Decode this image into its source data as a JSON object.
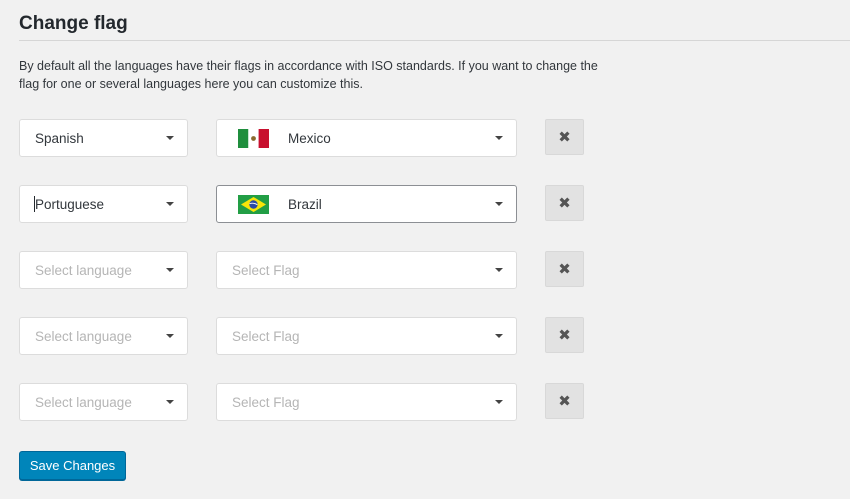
{
  "page": {
    "title": "Change flag",
    "description": "By default all the languages have their flags in accordance with ISO standards. If you want to change the flag for one or several languages here you can customize this."
  },
  "rows": [
    {
      "language": "Spanish",
      "flag": "Mexico",
      "flag_icon": "mexico-flag-icon"
    },
    {
      "language": "Portuguese",
      "flag": "Brazil",
      "flag_icon": "brazil-flag-icon"
    },
    {
      "language_placeholder": "Select language",
      "flag_placeholder": "Select Flag"
    },
    {
      "language_placeholder": "Select language",
      "flag_placeholder": "Select Flag"
    },
    {
      "language_placeholder": "Select language",
      "flag_placeholder": "Select Flag"
    }
  ],
  "remove_icon": "close-icon",
  "save_label": "Save Changes",
  "colors": {
    "primary_button": "#0085ba",
    "background": "#f1f1f1",
    "remove_button": "#e2e2e2"
  }
}
